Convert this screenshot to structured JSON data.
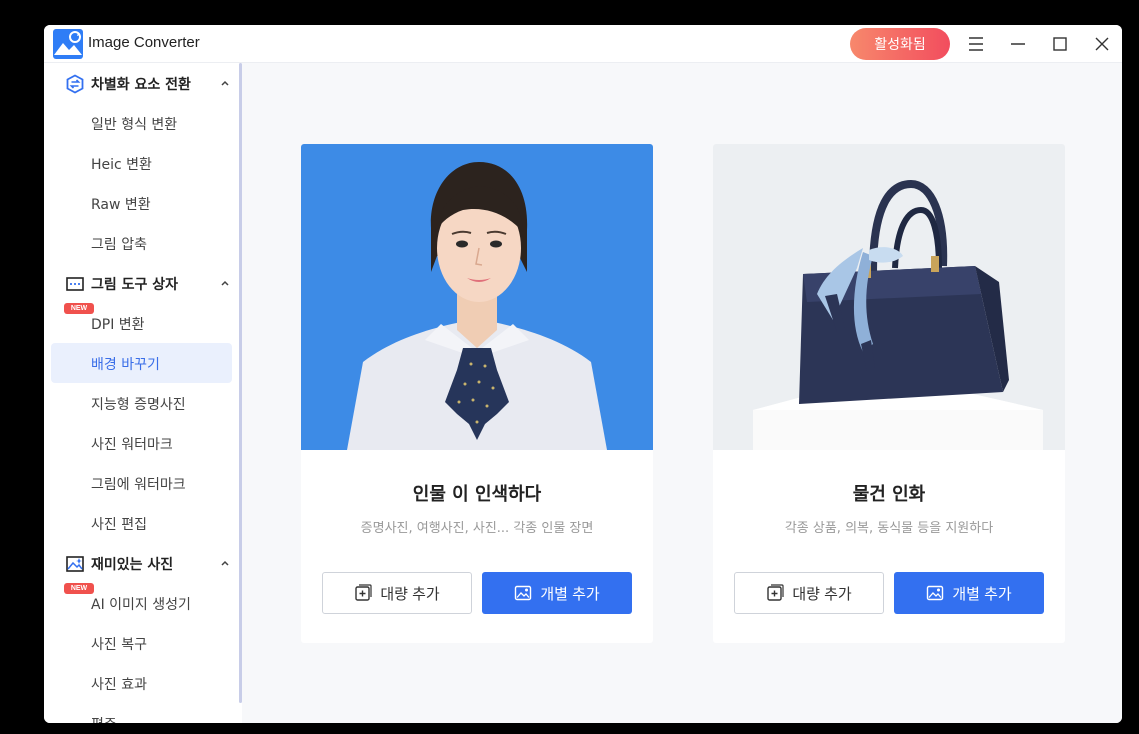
{
  "app": {
    "title": "Image Converter",
    "activate_label": "활성화됨"
  },
  "sidebar": {
    "groups": [
      {
        "label": "차별화 요소 전환",
        "icon": "convert-icon",
        "items": [
          {
            "label": "일반 형식 변환"
          },
          {
            "label": "Heic 변환"
          },
          {
            "label": "Raw 변환"
          },
          {
            "label": "그림 압축"
          }
        ]
      },
      {
        "label": "그림 도구 상자",
        "icon": "toolbox-icon",
        "items": [
          {
            "label": "DPI 변환",
            "badge": "NEW"
          },
          {
            "label": "배경 바꾸기",
            "active": true
          },
          {
            "label": "지능형 증명사진"
          },
          {
            "label": "사진 워터마크"
          },
          {
            "label": "그림에 워터마크"
          },
          {
            "label": "사진 편집"
          }
        ]
      },
      {
        "label": "재미있는 사진",
        "icon": "fun-photo-icon",
        "items": [
          {
            "label": "AI 이미지 생성기",
            "badge": "NEW"
          },
          {
            "label": "사진 복구"
          },
          {
            "label": "사진 효과"
          },
          {
            "label": "편주"
          }
        ]
      }
    ]
  },
  "cards": [
    {
      "title": "인물 이 인색하다",
      "desc": "증명사진, 여행사진, 사진... 각종 인물 장면",
      "batch_label": "대량 추가",
      "single_label": "개별 추가",
      "image": "portrait-photo"
    },
    {
      "title": "물건 인화",
      "desc": "각종 상품, 의복, 동식물 등을 지원하다",
      "batch_label": "대량 추가",
      "single_label": "개별 추가",
      "image": "handbag-photo"
    }
  ],
  "colors": {
    "accent": "#3370f0",
    "activate_gradient_start": "#f7886c",
    "activate_gradient_end": "#f24d5e",
    "new_badge": "#f0514d",
    "portrait_bg": "#3d8be6"
  }
}
